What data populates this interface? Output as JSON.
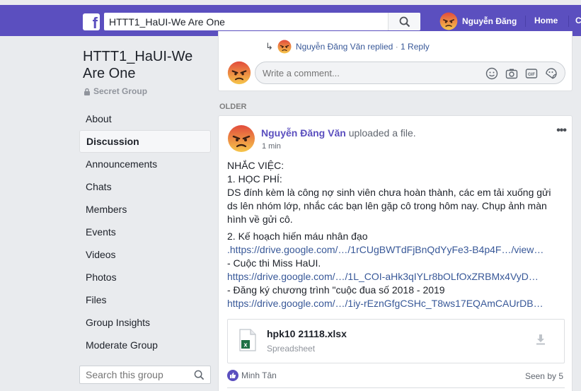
{
  "colors": {
    "brand": "#5b4fbf",
    "link": "#385898",
    "background": "#e9ebee"
  },
  "topbar": {
    "logo_icon": "facebook-f-icon",
    "search_value": "HTTT1_HaUI-We Are One",
    "user_name": "Nguyễn Đăng",
    "home_label": "Home",
    "cut_label": "C"
  },
  "sidebar": {
    "group_name": "HTTT1_HaUI-We Are One",
    "privacy_label": "Secret Group",
    "items": [
      {
        "label": "About",
        "active": false
      },
      {
        "label": "Discussion",
        "active": true
      },
      {
        "label": "Announcements",
        "active": false
      },
      {
        "label": "Chats",
        "active": false
      },
      {
        "label": "Members",
        "active": false
      },
      {
        "label": "Events",
        "active": false
      },
      {
        "label": "Videos",
        "active": false
      },
      {
        "label": "Photos",
        "active": false
      },
      {
        "label": "Files",
        "active": false
      },
      {
        "label": "Group Insights",
        "active": false
      },
      {
        "label": "Moderate Group",
        "active": false
      }
    ],
    "search_placeholder": "Search this group"
  },
  "previous_post": {
    "reply_author": "Nguyễn Đăng Văn",
    "reply_action": "replied",
    "reply_separator": "·",
    "reply_count": "1 Reply",
    "comment_placeholder": "Write a comment..."
  },
  "section_label": "OLDER",
  "post": {
    "author": "Nguyễn Đăng Văn",
    "action": "uploaded a file.",
    "time": "1 min",
    "more": "•••",
    "lines": [
      "NHẮC VIỆC:",
      "1. HỌC PHÍ:",
      "DS đính kèm là công nợ sinh viên chưa hoàn thành, các em tải xuống gửi ds lên nhóm lớp, nhắc các bạn lên gặp cô trong hôm nay. Chụp ảnh màn hình về gửi cô."
    ],
    "item2_title": "2. Kế hoạch hiến máu nhân đạo",
    "item2_link": ".https://drive.google.com/…/1rCUgBWTdFjBnQdYyFe3-B4p4F…/view…",
    "item3_title": "- Cuộc thi Miss HaUI.",
    "item3_link": "https://drive.google.com/…/1L_COI-aHk3qIYLr8bOLfOxZRBMx4VyD…",
    "item4_title": "- Đăng ký chương trình \"cuộc đua số 2018 - 2019",
    "item4_link": "https://drive.google.com/…/1iy-rEznGfgCSHc_T8ws17EQAmCAUrDB…",
    "file": {
      "name": "hpk10 21118.xlsx",
      "type": "Spreadsheet",
      "icon": "excel-file-icon"
    },
    "liker": "Minh Tân",
    "seen_by": "Seen by 5"
  }
}
